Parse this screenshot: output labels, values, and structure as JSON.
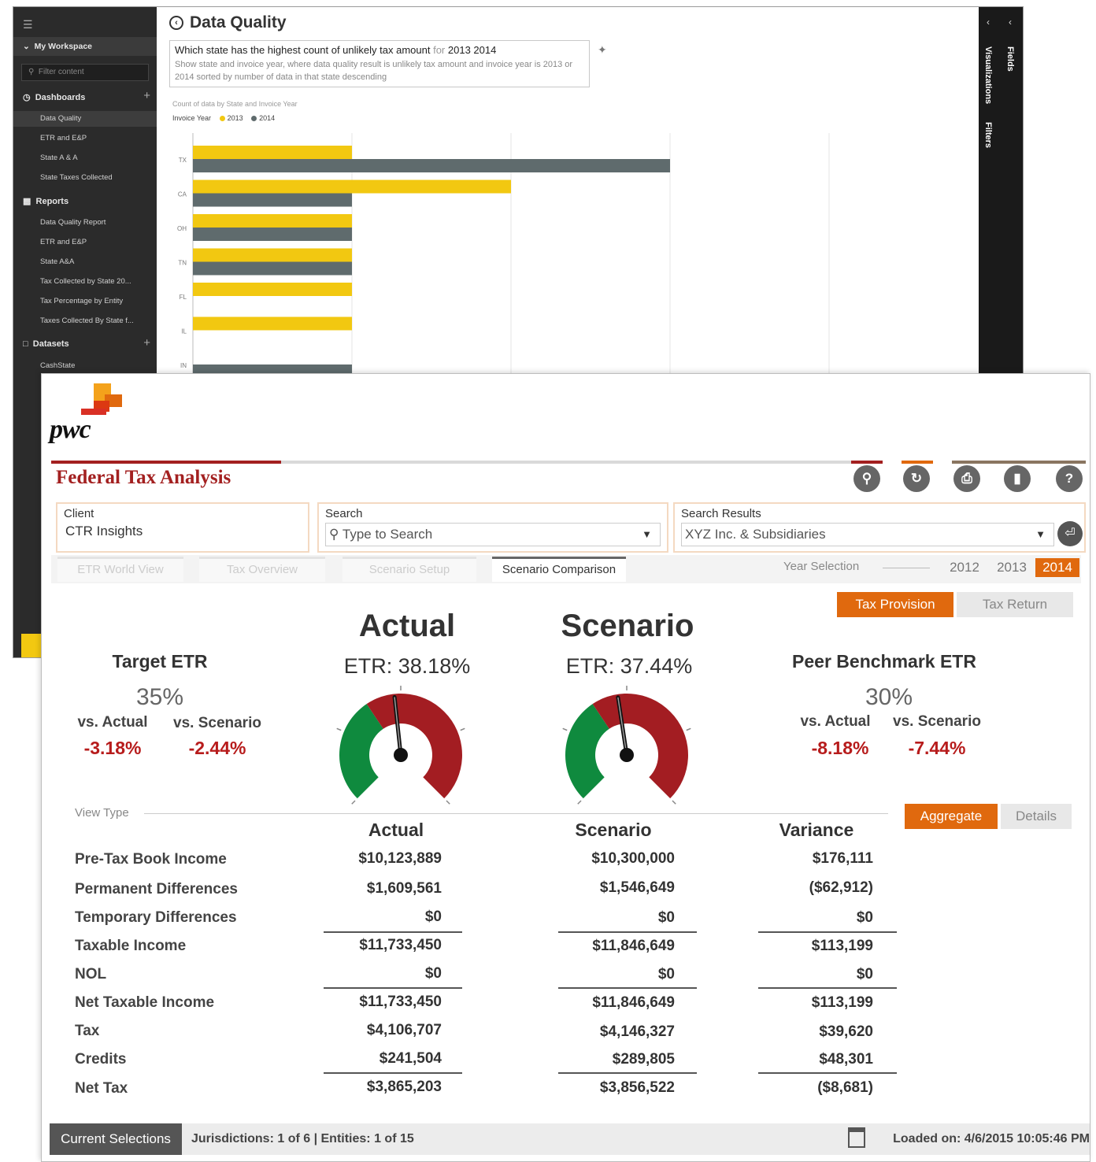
{
  "pbi": {
    "nav": {
      "workspace": "My Workspace",
      "filter_placeholder": "Filter content",
      "dashboards_label": "Dashboards",
      "dashboards": [
        "Data Quality",
        "ETR and E&P",
        "State A & A",
        "State Taxes Collected"
      ],
      "reports_label": "Reports",
      "reports": [
        "Data Quality Report",
        "ETR and E&P",
        "State A&A",
        "Tax Collected by State 20...",
        "Tax Percentage by Entity",
        "Taxes Collected By State f..."
      ],
      "datasets_label": "Datasets",
      "datasets": [
        "CashState"
      ]
    },
    "title": "Data Quality",
    "qa": {
      "question": "Which state has the highest count of unlikely tax amount",
      "question_suffix": "for",
      "question_years": "2013 2014",
      "hint": "Show state and invoice year, where data quality result is unlikely tax amount and invoice year is 2013 or 2014 sorted by number of data in that state descending"
    },
    "panes": {
      "visualizations": "Visualizations",
      "filters": "Filters",
      "fields": "Fields"
    },
    "chart_data": {
      "type": "bar",
      "title": "Count of data by State and Invoice Year",
      "legend_title": "Invoice Year",
      "categories": [
        "TX",
        "CA",
        "OH",
        "TN",
        "FL",
        "IL",
        "IN"
      ],
      "series": [
        {
          "name": "2013",
          "color": "#f2c811",
          "values": [
            1,
            2,
            1,
            1,
            1,
            1,
            0
          ]
        },
        {
          "name": "2014",
          "color": "#5f6b6d",
          "values": [
            3,
            1,
            1,
            1,
            0,
            0,
            1
          ]
        }
      ],
      "xlim": [
        0,
        4
      ],
      "grid": true
    }
  },
  "pwc": {
    "logo": "pwc",
    "app_title": "Federal Tax Analysis",
    "toolbar_icons": [
      "search-icon",
      "refresh-icon",
      "print-icon",
      "bookmark-icon",
      "help-icon"
    ],
    "client": {
      "label": "Client",
      "value": "CTR Insights"
    },
    "search": {
      "label": "Search",
      "placeholder": "Type to Search"
    },
    "search_results": {
      "label": "Search Results",
      "value": "XYZ Inc. & Subsidiaries"
    },
    "tabs": [
      "ETR World View",
      "Tax Overview",
      "Scenario Setup",
      "Scenario Comparison"
    ],
    "active_tab": "Scenario Comparison",
    "year_selection": {
      "label": "Year Selection",
      "years": [
        "2012",
        "2013",
        "2014"
      ],
      "selected": "2014"
    },
    "mode": {
      "on": "Tax Provision",
      "off": "Tax Return"
    },
    "target": {
      "title": "Target ETR",
      "pct": "35%",
      "vs_actual_label": "vs. Actual",
      "vs_scenario_label": "vs. Scenario",
      "vs_actual": "-3.18%",
      "vs_scenario": "-2.44%"
    },
    "actual": {
      "head": "Actual",
      "etr": "ETR:  38.18%",
      "etr_value": 38.18
    },
    "scenario": {
      "head": "Scenario",
      "etr": "ETR:  37.44%",
      "etr_value": 37.44
    },
    "peer": {
      "title": "Peer Benchmark ETR",
      "pct": "30%",
      "vs_actual_label": "vs. Actual",
      "vs_scenario_label": "vs. Scenario",
      "vs_actual": "-8.18%",
      "vs_scenario": "-7.44%"
    },
    "gauge_colors": {
      "good": "#0f8a3e",
      "bad": "#a31d22"
    },
    "view_type": {
      "label": "View Type",
      "on": "Aggregate",
      "off": "Details"
    },
    "table": {
      "columns": [
        "Actual",
        "Scenario",
        "Variance"
      ],
      "rows": [
        {
          "label": "Pre-Tax Book Income",
          "actual": "$10,123,889",
          "scenario": "$10,300,000",
          "variance": "$176,111"
        },
        {
          "label": "Permanent Differences",
          "actual": "$1,609,561",
          "scenario": "$1,546,649",
          "variance": "($62,912)"
        },
        {
          "label": "Temporary Differences",
          "actual": "$0",
          "scenario": "$0",
          "variance": "$0"
        },
        {
          "label": "Taxable Income",
          "actual": "$11,733,450",
          "scenario": "$11,846,649",
          "variance": "$113,199"
        },
        {
          "label": "NOL",
          "actual": "$0",
          "scenario": "$0",
          "variance": "$0"
        },
        {
          "label": "Net Taxable Income",
          "actual": "$11,733,450",
          "scenario": "$11,846,649",
          "variance": "$113,199"
        },
        {
          "label": "Tax",
          "actual": "$4,106,707",
          "scenario": "$4,146,327",
          "variance": "$39,620"
        },
        {
          "label": "Credits",
          "actual": "$241,504",
          "scenario": "$289,805",
          "variance": "$48,301"
        },
        {
          "label": "Net Tax",
          "actual": "$3,865,203",
          "scenario": "$3,856,522",
          "variance": "($8,681)"
        }
      ]
    },
    "status": {
      "current_selections": "Current Selections",
      "summary": "Jurisdictions: 1 of 6  |  Entities: 1 of 15",
      "loaded": "Loaded on: 4/6/2015 10:05:46 PM"
    }
  }
}
